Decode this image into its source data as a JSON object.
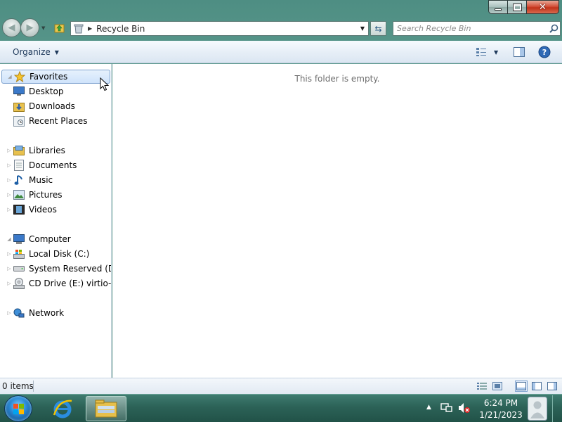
{
  "window": {
    "caption_buttons": {
      "minimize_icon": "minimize-icon",
      "maximize_icon": "restore-icon",
      "close_label": "✕"
    }
  },
  "navbar": {
    "address": "Recycle Bin",
    "search_placeholder": "Search Recycle Bin"
  },
  "commandbar": {
    "organize_label": "Organize",
    "icons": [
      "views-icon",
      "preview-pane-icon",
      "help-icon"
    ]
  },
  "navpane": {
    "favorites": {
      "label": "Favorites",
      "items": [
        "Desktop",
        "Downloads",
        "Recent Places"
      ]
    },
    "libraries": {
      "label": "Libraries",
      "items": [
        "Documents",
        "Music",
        "Pictures",
        "Videos"
      ]
    },
    "computer": {
      "label": "Computer",
      "items": [
        "Local Disk (C:)",
        "System Reserved (D:",
        "CD Drive (E:) virtio-v"
      ]
    },
    "network": {
      "label": "Network"
    }
  },
  "content": {
    "empty_message": "This folder is empty."
  },
  "statusbar": {
    "item_count": "0 items"
  },
  "taskbar": {
    "time": "6:24 PM",
    "date": "1/21/2023",
    "colors": {
      "accent": "#2c6257",
      "start_orb": "#2b8ad6"
    }
  }
}
